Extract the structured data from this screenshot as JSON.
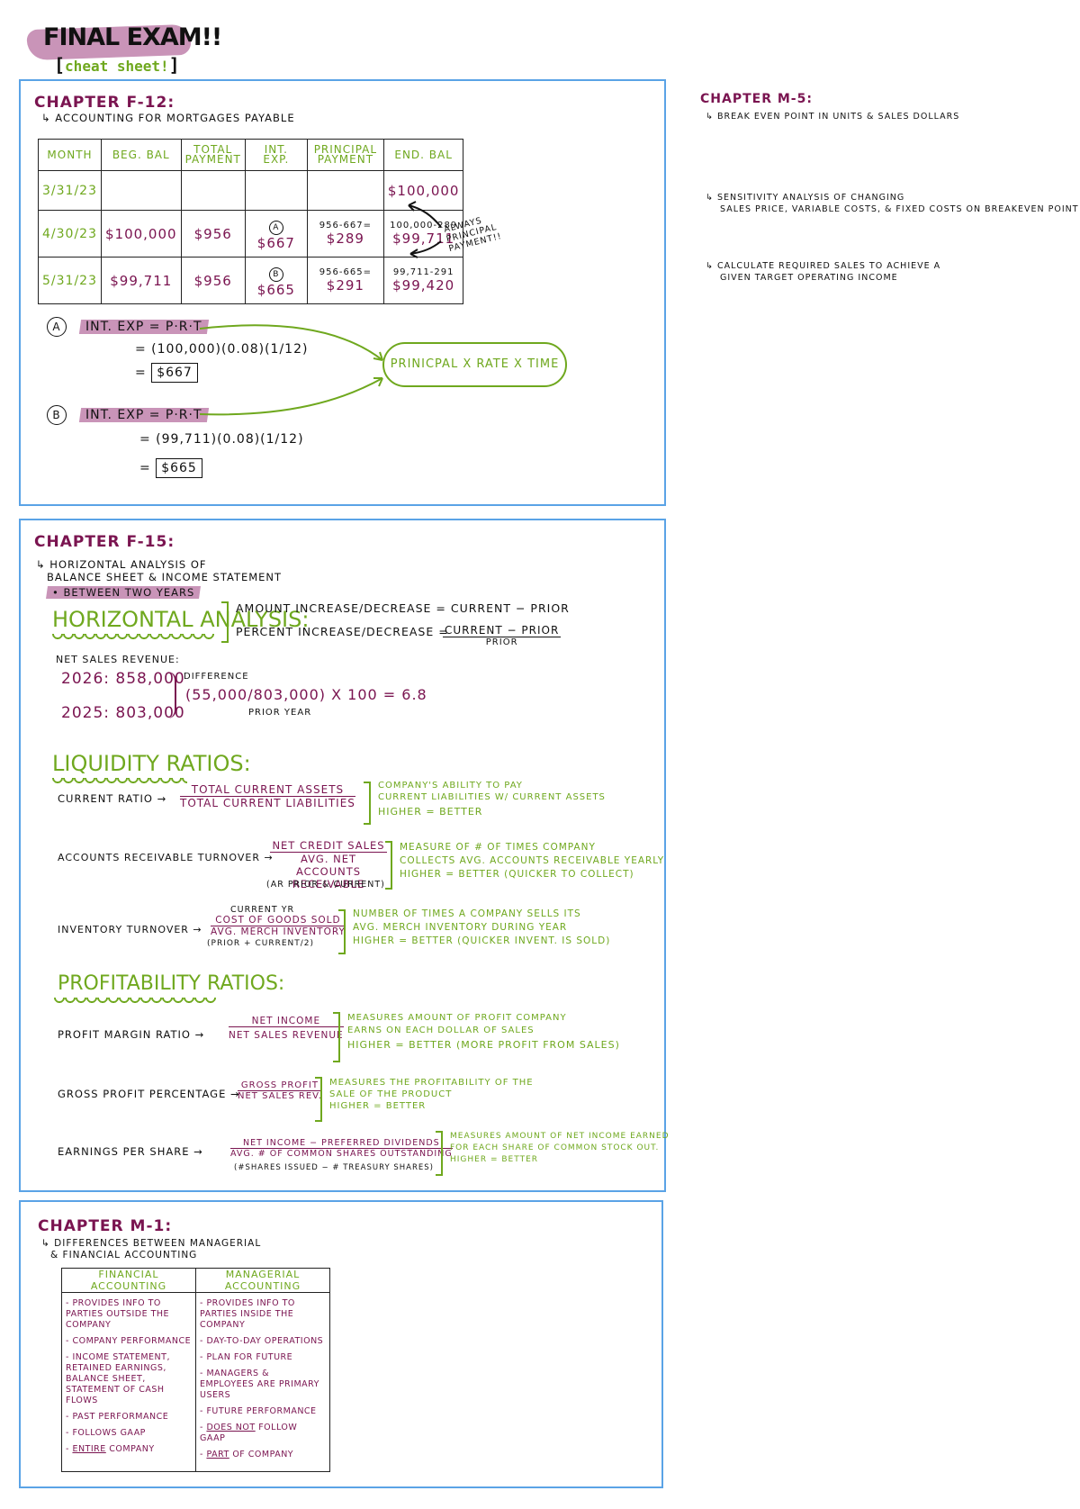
{
  "header": {
    "title": "FINAL EXAM!!",
    "subtitle": "cheat sheet!"
  },
  "colors": {
    "plum": "#7a1450",
    "green": "#6fa81e",
    "highlight": "#c994b8",
    "panel_border": "#5aa3e6"
  },
  "f12": {
    "chapter": "CHAPTER F-12:",
    "subtitle": "↳ ACCOUNTING FOR MORTGAGES PAYABLE",
    "table": {
      "headers": [
        "MONTH",
        "BEG. BAL",
        "TOTAL PAYMENT",
        "INT. EXP.",
        "PRINCIPAL PAYMENT",
        "END. BAL"
      ],
      "rows": [
        {
          "month": "3/31/23",
          "beg": "",
          "total": "",
          "int_marker": "",
          "int": "",
          "prin_calc": "",
          "prin": "",
          "end_calc": "",
          "end": "$100,000"
        },
        {
          "month": "4/30/23",
          "beg": "$100,000",
          "total": "$956",
          "int_marker": "A",
          "int": "$667",
          "prin_calc": "956-667=",
          "prin": "$289",
          "end_calc": "100,000-289",
          "end": "$99,711"
        },
        {
          "month": "5/31/23",
          "beg": "$99,711",
          "total": "$956",
          "int_marker": "B",
          "int": "$665",
          "prin_calc": "956-665=",
          "prin": "$291",
          "end_calc": "99,711-291",
          "end": "$99,420"
        }
      ]
    },
    "note": "ALWAYS PRINCIPAL PAYMENT!!",
    "calc_a": {
      "marker": "A",
      "formula": "INT. EXP = P·R·T",
      "step": "= (100,000)(0.08)(1/12)",
      "eq": "=",
      "result": "$667"
    },
    "calc_b": {
      "marker": "B",
      "formula": "INT. EXP = P·R·T",
      "step": "= (99,711)(0.08)(1/12)",
      "eq": "=",
      "result": "$665"
    },
    "cloud": "PRINICPAL x RATE x TIME"
  },
  "m5": {
    "chapter": "CHAPTER M-5:",
    "items": [
      "↳ BREAK EVEN POINT IN UNITS & SALES DOLLARS",
      "↳ SENSITIVITY ANALYSIS OF CHANGING",
      "SALES PRICE, VARIABLE COSTS, & FIXED COSTS ON BREAKEVEN POINT",
      "↳ CALCULATE REQUIRED SALES TO ACHIEVE A",
      "GIVEN TARGET OPERATING INCOME"
    ]
  },
  "f15": {
    "chapter": "CHAPTER F-15:",
    "sub1": "↳ HORIZONTAL ANALYSIS OF",
    "sub2": "BALANCE SHEET & INCOME STATEMENT",
    "sub3": "• BETWEEN TWO YEARS",
    "horizontal": {
      "heading": "HORIZONTAL ANALYSIS:",
      "amount": "AMOUNT INCREASE/DECREASE = CURRENT − PRIOR",
      "percent_label": "PERCENT INCREASE/DECREASE =",
      "percent_num": "CURRENT − PRIOR",
      "percent_den": "PRIOR"
    },
    "example": {
      "label": "NET SALES REVENUE:",
      "y2026": "2026: 858,000",
      "y2025": "2025: 803,000",
      "difference": "DIFFERENCE",
      "calc": "(55,000/803,000) x 100 = 6.8",
      "prior_year": "PRIOR YEAR"
    },
    "liquidity": {
      "heading": "LIQUIDITY RATIOS:",
      "ratios": [
        {
          "name": "CURRENT RATIO →",
          "top_note": "",
          "num": "TOTAL CURRENT ASSETS",
          "den": "TOTAL CURRENT LIABILITIES",
          "sub": "",
          "desc": [
            "COMPANY'S ABILITY TO PAY",
            "CURRENT LIABILITIES W/ CURRENT ASSETS",
            "HIGHER = BETTER"
          ]
        },
        {
          "name": "ACCOUNTS RECEIVABLE TURNOVER →",
          "top_note": "",
          "num": "NET CREDIT SALES",
          "den": "AVG. NET ACCOUNTS RECEIVABLE",
          "sub": "(AR PRIOR & CURRENT)",
          "desc": [
            "MEASURE OF # OF TIMES COMPANY",
            "COLLECTS AVG. ACCOUNTS RECEIVABLE YEARLY",
            "HIGHER = BETTER (QUICKER TO COLLECT)"
          ]
        },
        {
          "name": "INVENTORY TURNOVER →",
          "top_note": "CURRENT YR",
          "num": "COST OF GOODS SOLD",
          "den": "AVG. MERCH INVENTORY",
          "sub": "(PRIOR + CURRENT/2)",
          "desc": [
            "NUMBER OF TIMES A COMPANY SELLS ITS",
            "AVG. MERCH INVENTORY DURING YEAR",
            "HIGHER = BETTER (QUICKER INVENT. IS SOLD)"
          ]
        }
      ]
    },
    "profitability": {
      "heading": "PROFITABILITY RATIOS:",
      "ratios": [
        {
          "name": "PROFIT MARGIN RATIO →",
          "num": "NET INCOME",
          "den": "NET SALES REVENUE",
          "sub": "",
          "desc": [
            "MEASURES AMOUNT OF PROFIT COMPANY",
            "EARNS ON EACH DOLLAR OF SALES",
            "HIGHER = BETTER (MORE PROFIT FROM SALES)"
          ]
        },
        {
          "name": "GROSS PROFIT PERCENTAGE →",
          "num": "GROSS PROFIT",
          "den": "NET SALES REV.",
          "sub": "",
          "desc": [
            "MEASURES THE PROFITABILITY OF THE",
            "SALE OF THE PRODUCT",
            "HIGHER = BETTER"
          ]
        },
        {
          "name": "EARNINGS PER SHARE →",
          "num": "NET INCOME − PREFERRED DIVIDENDS",
          "den": "AVG. # OF COMMON SHARES OUTSTANDING",
          "sub": "(#SHARES ISSUED − # TREASURY SHARES)",
          "desc": [
            "MEASURES AMOUNT OF NET INCOME EARNED",
            "FOR EACH SHARE OF COMMON STOCK OUT.",
            "HIGHER = BETTER"
          ]
        }
      ]
    }
  },
  "m1": {
    "chapter": "CHAPTER M-1:",
    "sub1": "↳ DIFFERENCES BETWEEN MANAGERIAL",
    "sub2": "& FINANCIAL ACCOUNTING",
    "table": {
      "headers": [
        "FINANCIAL ACCOUNTING",
        "MANAGERIAL ACCOUNTING"
      ],
      "financial": [
        {
          "pre": "- ",
          "u": "",
          "text": "PROVIDES INFO TO PARTIES OUTSIDE THE COMPANY"
        },
        {
          "pre": "- ",
          "u": "",
          "text": "COMPANY PERFORMANCE"
        },
        {
          "pre": "- ",
          "u": "",
          "text": "INCOME STATEMENT, RETAINED EARNINGS, BALANCE SHEET, STATEMENT OF CASH FLOWS"
        },
        {
          "pre": "- ",
          "u": "",
          "text": "PAST PERFORMANCE"
        },
        {
          "pre": "- ",
          "u": "",
          "text": "FOLLOWS GAAP"
        },
        {
          "pre": "- ",
          "u": "ENTIRE",
          "text": " COMPANY"
        }
      ],
      "managerial": [
        {
          "pre": "- ",
          "u": "",
          "text": "PROVIDES INFO TO PARTIES INSIDE THE COMPANY"
        },
        {
          "pre": "- ",
          "u": "",
          "text": "DAY-TO-DAY OPERATIONS"
        },
        {
          "pre": "- ",
          "u": "",
          "text": "PLAN FOR FUTURE"
        },
        {
          "pre": "- ",
          "u": "",
          "text": "MANAGERS & EMPLOYEES ARE PRIMARY USERS"
        },
        {
          "pre": "- ",
          "u": "",
          "text": "FUTURE PERFORMANCE"
        },
        {
          "pre": "- ",
          "u": "DOES NOT",
          "text": " FOLLOW GAAP"
        },
        {
          "pre": "- ",
          "u": "PART",
          "text": " OF COMPANY"
        }
      ]
    }
  }
}
